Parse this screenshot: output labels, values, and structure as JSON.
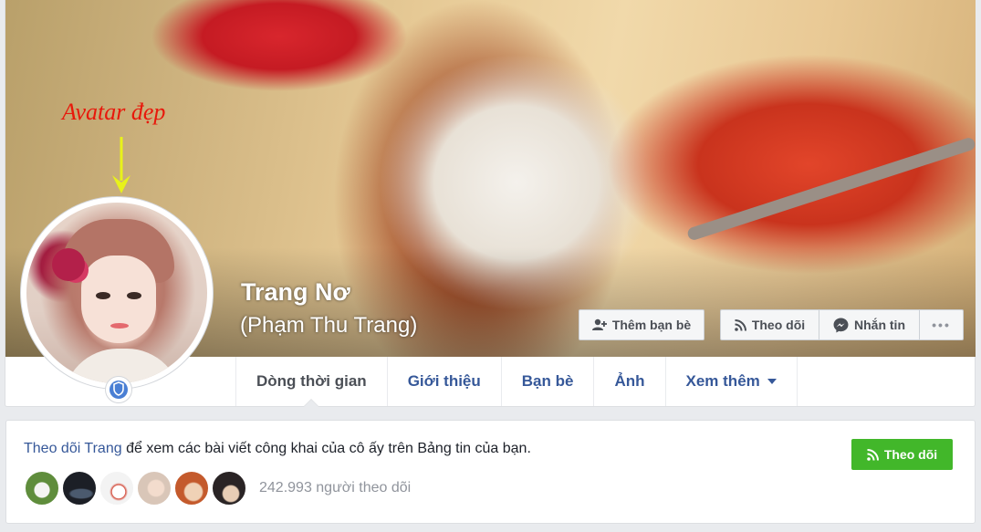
{
  "annotation": {
    "text": "Avatar đẹp",
    "color": "#e8180b",
    "arrow_color": "#e8f21a"
  },
  "profile": {
    "name": "Trang Nơ",
    "alternate_name": "(Phạm Thu Trang)"
  },
  "cover_actions": {
    "add_friend": "Thêm bạn bè",
    "follow": "Theo dõi",
    "message": "Nhắn tin",
    "more": "•••"
  },
  "nav": {
    "items": [
      {
        "label": "Dòng thời gian",
        "active": true
      },
      {
        "label": "Giới thiệu"
      },
      {
        "label": "Bạn bè"
      },
      {
        "label": "Ảnh"
      },
      {
        "label": "Xem thêm"
      }
    ]
  },
  "follow_card": {
    "link_text": "Theo dõi Trang",
    "rest_text": " để xem các bài viết công khai của cô ấy trên Bảng tin của bạn.",
    "button_label": "Theo dõi",
    "followers_count": "242.993 người theo dõi",
    "follower_avatars": [
      {
        "color": "#5f8d3c",
        "accent": "#f4f4f2"
      },
      {
        "color": "#1c1f26",
        "accent": "#4b5a6e"
      },
      {
        "color": "#f3f3f3",
        "accent": "#d44a3a"
      },
      {
        "color": "#d9c6b8",
        "accent": "#8c6a4d"
      },
      {
        "color": "#c45a2c",
        "accent": "#f0d2b6"
      },
      {
        "color": "#2a2425",
        "accent": "#e8cdb5"
      }
    ]
  },
  "colors": {
    "link_blue": "#365899",
    "follow_green": "#42b72a",
    "badge_blue": "#4a7fd4"
  }
}
